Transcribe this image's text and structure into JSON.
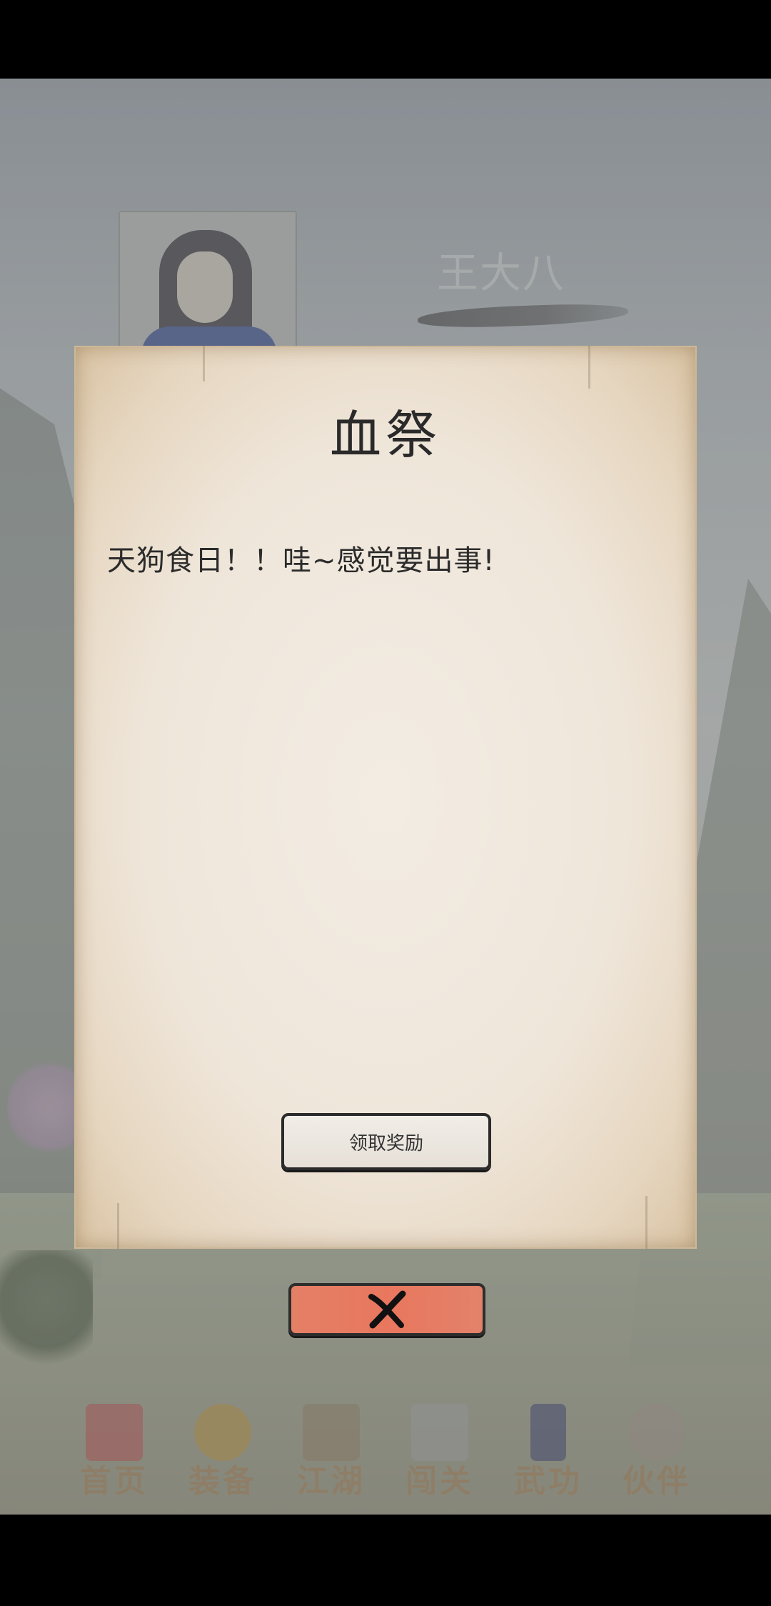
{
  "player": {
    "name": "王大八"
  },
  "modal": {
    "title": "血祭",
    "message": "天狗食日！！哇~感觉要出事!",
    "claim_button_label": "领取奖励",
    "close_icon": "close-icon"
  },
  "bottom_nav": {
    "items": [
      {
        "label": "首页",
        "icon": "home-icon",
        "color": "#b05050"
      },
      {
        "label": "装备",
        "icon": "equipment-icon",
        "color": "#b08a3a"
      },
      {
        "label": "江湖",
        "icon": "jianghu-icon",
        "color": "#8a7a60"
      },
      {
        "label": "闯关",
        "icon": "stage-icon",
        "color": "#9a9a9a"
      },
      {
        "label": "武功",
        "icon": "martial-arts-icon",
        "color": "#3a3f6a"
      },
      {
        "label": "伙伴",
        "icon": "partners-icon",
        "color": "#9a8a80"
      }
    ]
  },
  "colors": {
    "close_button": "#e8775e",
    "parchment": "#efe6da"
  }
}
